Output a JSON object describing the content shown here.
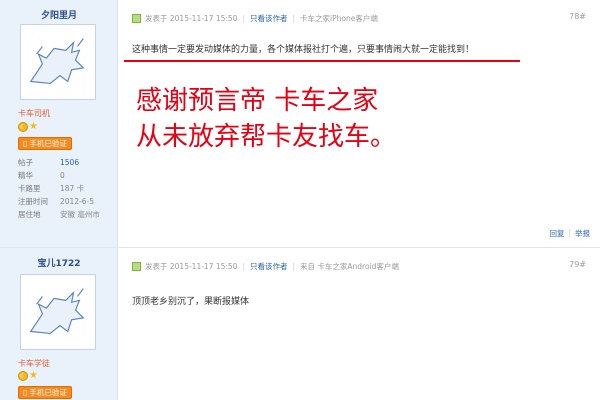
{
  "posts": [
    {
      "username": "夕阳里月",
      "user_level": "卡车司机",
      "phone_badge": "手机已验证",
      "stats": [
        {
          "label": "帖子",
          "value": "1506"
        },
        {
          "label": "精华",
          "value": "0"
        },
        {
          "label": "卡路里",
          "value": "187 卡"
        },
        {
          "label": "注册时间",
          "value": "2012-6-5"
        },
        {
          "label": "居住地",
          "value": "安徽 亳州市"
        }
      ],
      "posted_at": "发表于 2015-11-17 15:50",
      "only_author": "只看该作者",
      "client": "卡车之家iPhone客户端",
      "floor": "78#",
      "text": "这种事情一定要发动媒体的力量，各个媒体报社打个遍，只要事情闹大就一定能找到！",
      "overlay_line1": "感谢预言帝 卡车之家",
      "overlay_line2": "从未放弃帮卡友找车。",
      "reply": "回复",
      "report": "举报"
    },
    {
      "username": "宝儿1722",
      "user_level": "卡车学徒",
      "phone_badge": "手机已验证",
      "posted_at": "发表于 2015-11-17 15:50",
      "only_author": "只看该作者",
      "client": "来自 卡车之家Android客户端",
      "floor": "79#",
      "text": "顶顶老乡别沉了，果断报媒体"
    }
  ],
  "colors": {
    "sidebar_bg": "#e9f1fa",
    "link_blue": "#2b64b8",
    "accent_red": "#e60012",
    "badge_orange": "#f78a1f"
  }
}
